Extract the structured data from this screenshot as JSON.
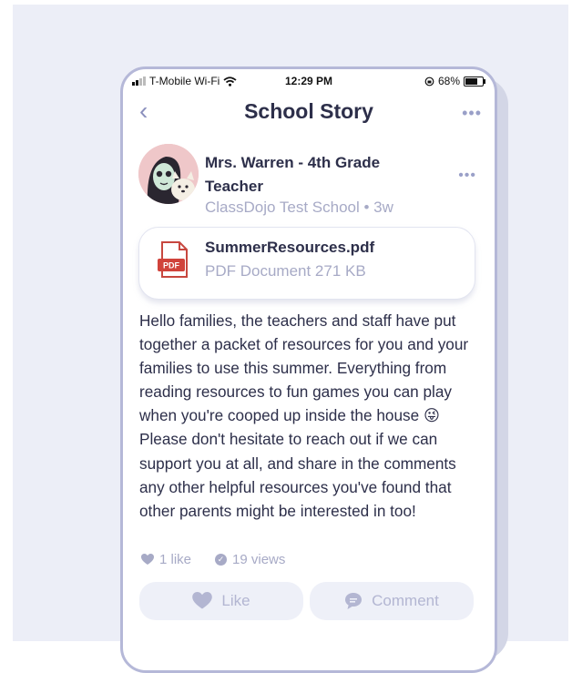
{
  "status_bar": {
    "carrier": "T-Mobile Wi-Fi",
    "time": "12:29 PM",
    "battery": "68%"
  },
  "nav": {
    "title": "School Story",
    "back_icon": "chevron-left-icon",
    "more_icon": "ellipsis-icon"
  },
  "post": {
    "author": "Mrs. Warren - 4th Grade Teacher",
    "school_time": "ClassDojo Test School • 3w",
    "attachment": {
      "name": "SummerResources.pdf",
      "meta": "PDF Document 271 KB",
      "icon": "pdf-icon"
    },
    "body_part1": "Hello families, the teachers and staff have put together a packet of resources for you and your families to use this summer. Everything from reading resources to fun games you can play when you're cooped up inside the house ",
    "emoji": "😜",
    "body_part2": " Please don't hesitate to reach out if we can support you at all, and share in the comments any other helpful resources you've found that other parents might be interested in too!",
    "likes": "1 like",
    "views": "19 views"
  },
  "actions": {
    "like_label": "Like",
    "comment_label": "Comment"
  },
  "colors": {
    "accent": "#8b90bd",
    "text": "#2d2f4a",
    "muted": "#a7aac6",
    "pdf_red": "#d0433b"
  }
}
